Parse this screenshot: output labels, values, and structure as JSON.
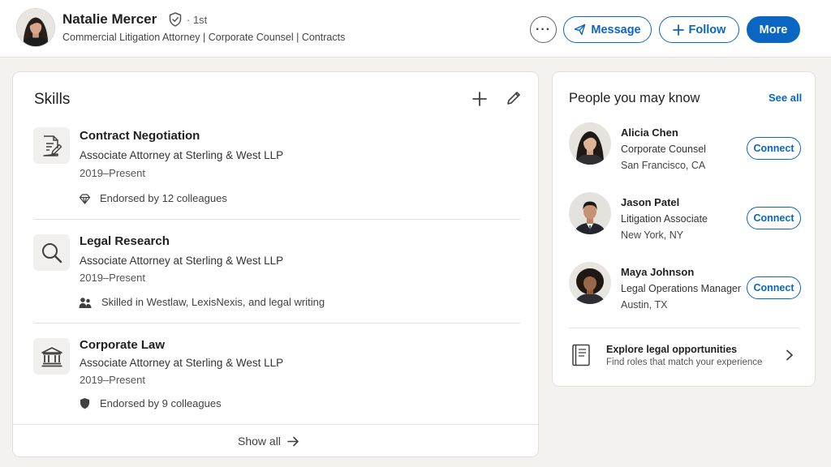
{
  "header": {
    "name": "Natalie Mercer",
    "degree": "· 1st",
    "headline": "Commercial Litigation Attorney | Corporate Counsel | Contracts",
    "buttons": {
      "more_options": "···",
      "message": "Message",
      "follow": "Follow",
      "more": "More"
    }
  },
  "skills": {
    "title": "Skills",
    "items": [
      {
        "name": "Contract Negotiation",
        "role": "Associate Attorney at Sterling & West LLP",
        "dates": "2019–Present",
        "note": "Endorsed by 12 colleagues",
        "icon": "document-edit-icon",
        "note_icon": "diamond-icon"
      },
      {
        "name": "Legal Research",
        "role": "Associate Attorney at Sterling & West LLP",
        "dates": "2019–Present",
        "note": "Skilled in Westlaw, LexisNexis, and legal writing",
        "icon": "search-icon",
        "note_icon": "people-icon"
      },
      {
        "name": "Corporate Law",
        "role": "Associate Attorney at Sterling & West LLP",
        "dates": "2019–Present",
        "note": "Endorsed by 9 colleagues",
        "icon": "courthouse-icon",
        "note_icon": "shield-icon"
      }
    ],
    "show_all": "Show all"
  },
  "pymk": {
    "title": "People you may know",
    "see_all": "See all",
    "people": [
      {
        "name": "Alicia Chen",
        "title": "Corporate Counsel",
        "location": "San Francisco, CA",
        "action": "Connect"
      },
      {
        "name": "Jason Patel",
        "title": "Litigation Associate",
        "location": "New York, NY",
        "action": "Connect"
      },
      {
        "name": "Maya Johnson",
        "title": "Legal Operations Manager",
        "location": "Austin, TX",
        "action": "Connect"
      }
    ],
    "explore": {
      "title": "Explore legal opportunities",
      "subtitle": "Find roles that match your experience"
    }
  },
  "colors": {
    "accent": "#0a66c2",
    "background": "#f3f2ef",
    "card": "#ffffff",
    "text": "#1f1f1f"
  }
}
